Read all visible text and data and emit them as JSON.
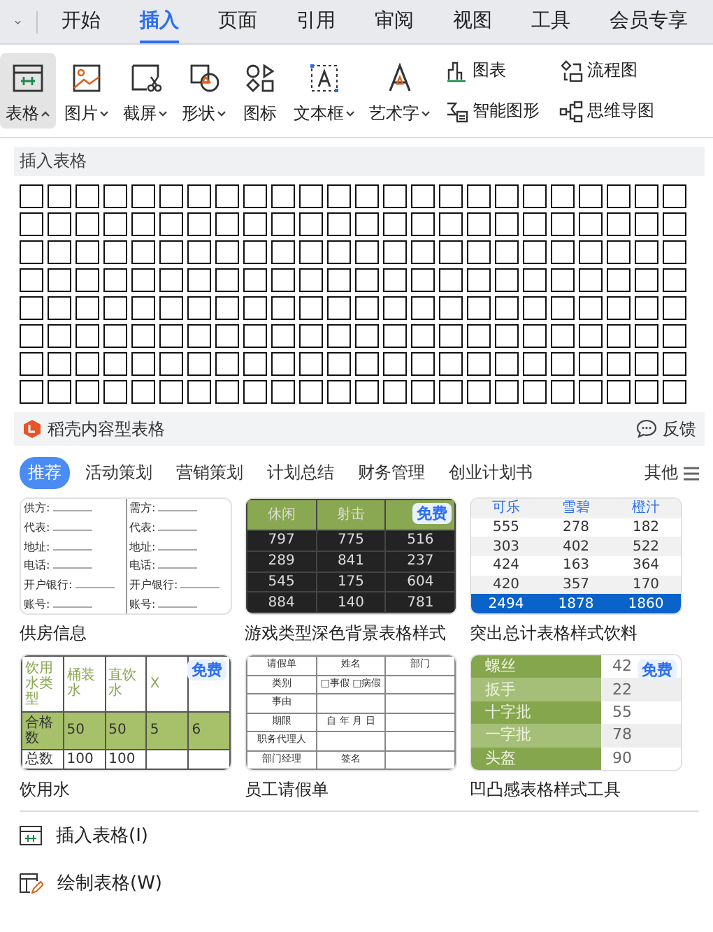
{
  "tabs": [
    {
      "label": "开始",
      "selected": false
    },
    {
      "label": "插入",
      "selected": true
    },
    {
      "label": "页面",
      "selected": false
    },
    {
      "label": "引用",
      "selected": false
    },
    {
      "label": "审阅",
      "selected": false
    },
    {
      "label": "视图",
      "selected": false
    },
    {
      "label": "工具",
      "selected": false
    },
    {
      "label": "会员专享",
      "selected": false
    }
  ],
  "ribbon": {
    "large": [
      {
        "label": "表格",
        "dropdown": true,
        "selected": true
      },
      {
        "label": "图片",
        "dropdown": true,
        "selected": false
      },
      {
        "label": "截屏",
        "dropdown": true,
        "selected": false
      },
      {
        "label": "形状",
        "dropdown": true,
        "selected": false
      },
      {
        "label": "图标",
        "dropdown": false,
        "selected": false
      },
      {
        "label": "文本框",
        "dropdown": true,
        "selected": false
      },
      {
        "label": "艺术字",
        "dropdown": true,
        "selected": false
      }
    ],
    "small": [
      {
        "label": "图表"
      },
      {
        "label": "流程图"
      },
      {
        "label": "智能图形"
      },
      {
        "label": "思维导图"
      }
    ]
  },
  "panel": {
    "grid_title": "插入表格",
    "docer": {
      "title": "稻壳内容型表格",
      "feedback": "反馈"
    },
    "categories": [
      {
        "label": "推荐",
        "selected": true
      },
      {
        "label": "活动策划",
        "selected": false
      },
      {
        "label": "营销策划",
        "selected": false
      },
      {
        "label": "计划总结",
        "selected": false
      },
      {
        "label": "财务管理",
        "selected": false
      },
      {
        "label": "创业计划书",
        "selected": false
      }
    ],
    "more": "其他",
    "templates": [
      {
        "kind": "form",
        "title": "供房信息",
        "rows": [
          [
            "供方:",
            "需方:"
          ],
          [
            "代表:",
            "代表:"
          ],
          [
            "地址:",
            "地址:"
          ],
          [
            "电话:",
            "电话:"
          ],
          [
            "开户银行:",
            "开户银行:"
          ],
          [
            "账号:",
            "账号:"
          ]
        ]
      },
      {
        "kind": "dark",
        "title": "游戏类型深色背景表格样式",
        "badge": "免费",
        "rows": [
          [
            "休闲",
            "射击",
            ""
          ],
          [
            "797",
            "775",
            "516"
          ],
          [
            "289",
            "841",
            "237"
          ],
          [
            "545",
            "175",
            "604"
          ],
          [
            "884",
            "140",
            "781"
          ]
        ]
      },
      {
        "kind": "total",
        "title": "突出总计表格样式饮料",
        "rows": [
          [
            "可乐",
            "雪碧",
            "橙汁"
          ],
          [
            "555",
            "278",
            "182"
          ],
          [
            "303",
            "402",
            "522"
          ],
          [
            "424",
            "163",
            "364"
          ],
          [
            "420",
            "357",
            "170"
          ],
          [
            "2494",
            "1878",
            "1860"
          ]
        ]
      },
      {
        "kind": "water",
        "title": "饮用水",
        "badge": "免费",
        "rows": [
          [
            "饮用水类型",
            "桶装水",
            "直饮水",
            "X",
            ""
          ],
          [
            "合格数",
            "50",
            "50",
            "5",
            "6"
          ],
          [
            "总数",
            "100",
            "100",
            "",
            ""
          ]
        ]
      },
      {
        "kind": "leave",
        "title": "员工请假单",
        "rows": [
          [
            "请假单",
            "姓名",
            "部门"
          ],
          [
            "类别",
            "□事假 □病假",
            ""
          ],
          [
            "事由",
            "",
            ""
          ],
          [
            "期限",
            "自 年 月 日",
            ""
          ],
          [
            "职务代理人",
            "",
            ""
          ],
          [
            "部门经理",
            "签名",
            ""
          ]
        ]
      },
      {
        "kind": "tool",
        "title": "凹凸感表格样式工具",
        "badge": "免费",
        "rows": [
          [
            "螺丝",
            "42"
          ],
          [
            "扳手",
            "22"
          ],
          [
            "十字批",
            "55"
          ],
          [
            "一字批",
            "78"
          ],
          [
            "头盔",
            "90"
          ]
        ]
      }
    ]
  },
  "menu": [
    {
      "label": "插入表格(I)"
    },
    {
      "label": "绘制表格(W)"
    }
  ]
}
